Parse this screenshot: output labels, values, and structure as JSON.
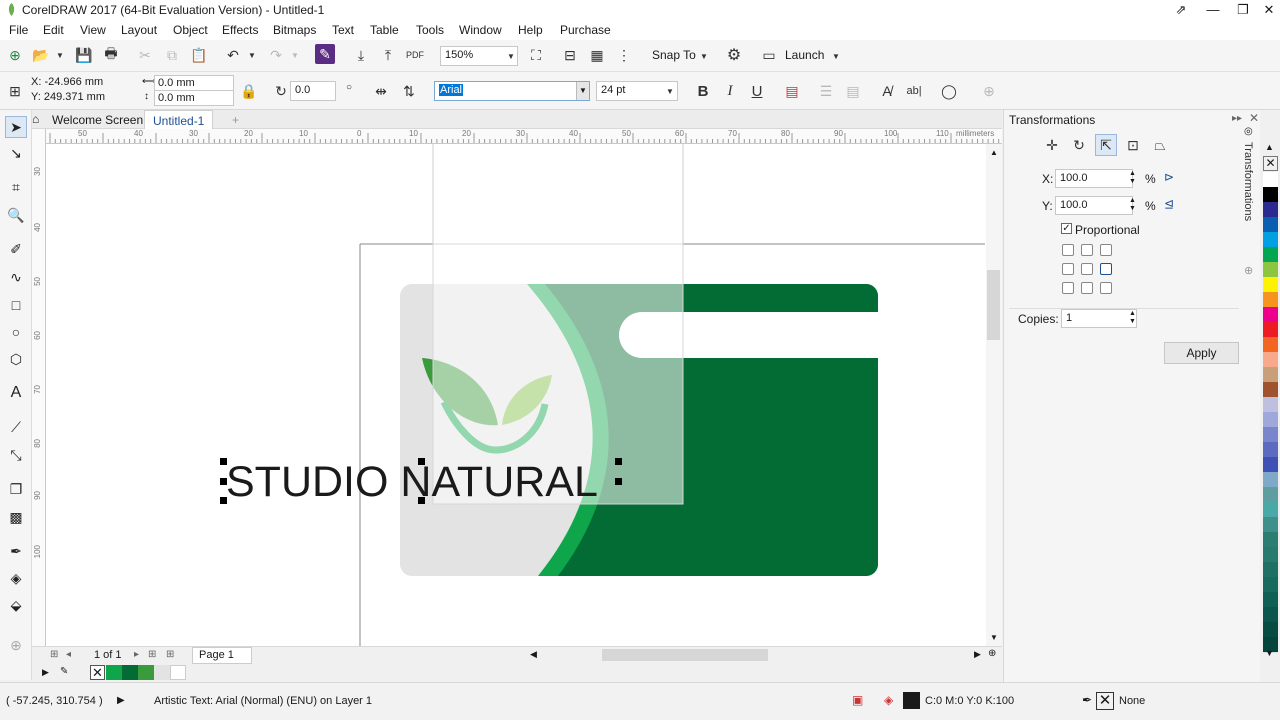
{
  "window": {
    "title": "CorelDRAW 2017 (64-Bit Evaluation Version) - Untitled-1",
    "controls": [
      "⇗",
      "—",
      "❐",
      "✕"
    ]
  },
  "menu": [
    "File",
    "Edit",
    "View",
    "Layout",
    "Object",
    "Effects",
    "Bitmaps",
    "Text",
    "Table",
    "Tools",
    "Window",
    "Help",
    "Purchase"
  ],
  "standard_bar": {
    "zoom": "150%",
    "snap_to": "Snap To",
    "launch": "Launch"
  },
  "property_bar": {
    "x": "X: -24.966 mm",
    "y": "Y: 249.371 mm",
    "width": "0.0 mm",
    "height": "0.0 mm",
    "angle": "0.0",
    "font": "Arial",
    "size": "24 pt",
    "bold": "B",
    "italic": "I",
    "underline": "U"
  },
  "doc_tabs": {
    "welcome": "Welcome Screen",
    "document": "Untitled-1",
    "add": "+"
  },
  "ruler": {
    "h_labels": [
      "50",
      "40",
      "30",
      "20",
      "10",
      "0",
      "10",
      "20",
      "30",
      "40",
      "50",
      "60",
      "70",
      "80",
      "90",
      "100",
      "110"
    ],
    "unit": "millimeters",
    "v_labels": [
      "30",
      "40",
      "50",
      "60",
      "70",
      "80",
      "90",
      "100"
    ]
  },
  "canvas": {
    "artistic_text": "STUDIO NATURAL"
  },
  "page_nav": {
    "counter": "1 of 1",
    "page_tab": "Page 1"
  },
  "status": {
    "coords": "( -57.245, 310.754 )",
    "object_info": "Artistic Text: Arial (Normal) (ENU) on Layer 1",
    "fill": "C:0 M:0 Y:0 K:100",
    "outline": "None"
  },
  "docker": {
    "title": "Transformations",
    "tab_label": "Transformations",
    "x_label": "X:",
    "x_value": "100.0",
    "y_label": "Y:",
    "y_value": "100.0",
    "percent": "%",
    "proportional": "Proportional",
    "copies_label": "Copies:",
    "copies_value": "1",
    "apply": "Apply"
  },
  "colors": {
    "dark_green": "#036b34",
    "bright_green": "#0fa64b",
    "light_green": "#6ab04c",
    "grey_card": "#e3e3e3",
    "selection": "#0078d7"
  },
  "palette": [
    "#ffffff",
    "#000000",
    "#2b2b8f",
    "#0b5fb0",
    "#00a0e3",
    "#00a651",
    "#8cc63f",
    "#fff200",
    "#f7941d",
    "#ec008c",
    "#ed1c24",
    "#f26522",
    "#f9a98b",
    "#c7a07a",
    "#a0522d",
    "#bfbfe0",
    "#9fa8da",
    "#7986cb",
    "#5c6bc0",
    "#3f51b5",
    "#7fa9c9",
    "#5f9ea0",
    "#48a9a6",
    "#3f8f8a",
    "#2e7d73",
    "#267a6e",
    "#1f6f64",
    "#18695e",
    "#0f5f55",
    "#0a554c",
    "#064c43",
    "#03453c"
  ]
}
